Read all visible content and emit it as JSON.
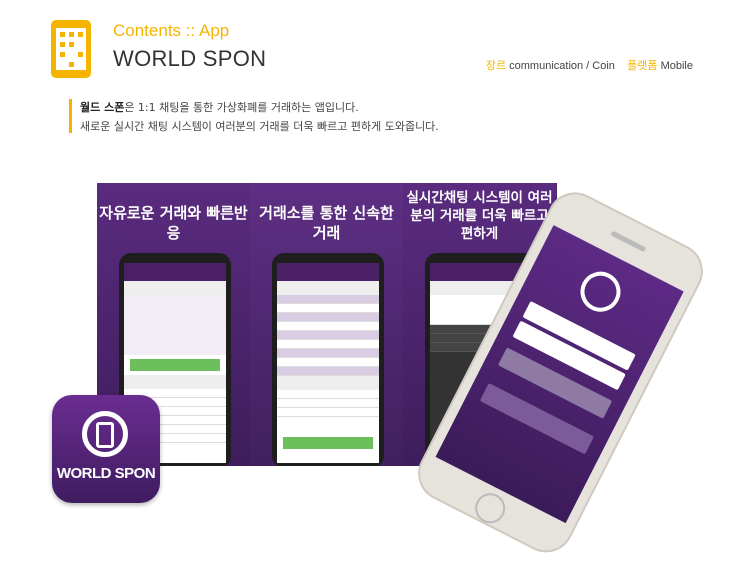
{
  "header": {
    "subtitle": "Contents :: App",
    "title": "WORLD SPON"
  },
  "meta": {
    "genre_label": "장르",
    "genre_value": "communication / Coin",
    "platform_label": "플랫폼",
    "platform_value": "Mobile"
  },
  "description": {
    "name": "월드 스폰",
    "line1_rest": "은 1:1 채팅을 통한 가상화폐를 거래하는 앱입니다.",
    "line2": "새로운 실시간 채팅 시스템이 여러분의 거래를 더욱 빠르고 편하게 도와줍니다."
  },
  "banner": {
    "panel1_title": "자유로운 거래와 빠른반응",
    "panel2_title": "거래소를 통한 신속한 거래",
    "panel3_title": "실시간채팅 시스템이 여러분의 거래를 더욱 빠르고 편하게"
  },
  "app_icon": {
    "label": "WORLD SPON"
  },
  "colors": {
    "accent": "#f5b400",
    "brand_purple": "#4f2570"
  }
}
